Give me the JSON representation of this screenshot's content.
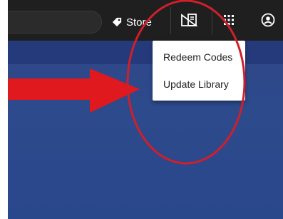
{
  "topbar": {
    "store_label": "Store"
  },
  "dropdown": {
    "items": [
      {
        "label": "Redeem Codes"
      },
      {
        "label": "Update Library"
      }
    ]
  },
  "annotation": {
    "arrow_color": "#e0191e",
    "circle_color": "#d11f2a"
  },
  "colors": {
    "topbar": "#1f1f1f",
    "background": "#2d4a8c"
  },
  "icons": [
    "tag-icon",
    "redeem-card-icon",
    "grid-icon",
    "account-circle-icon"
  ]
}
